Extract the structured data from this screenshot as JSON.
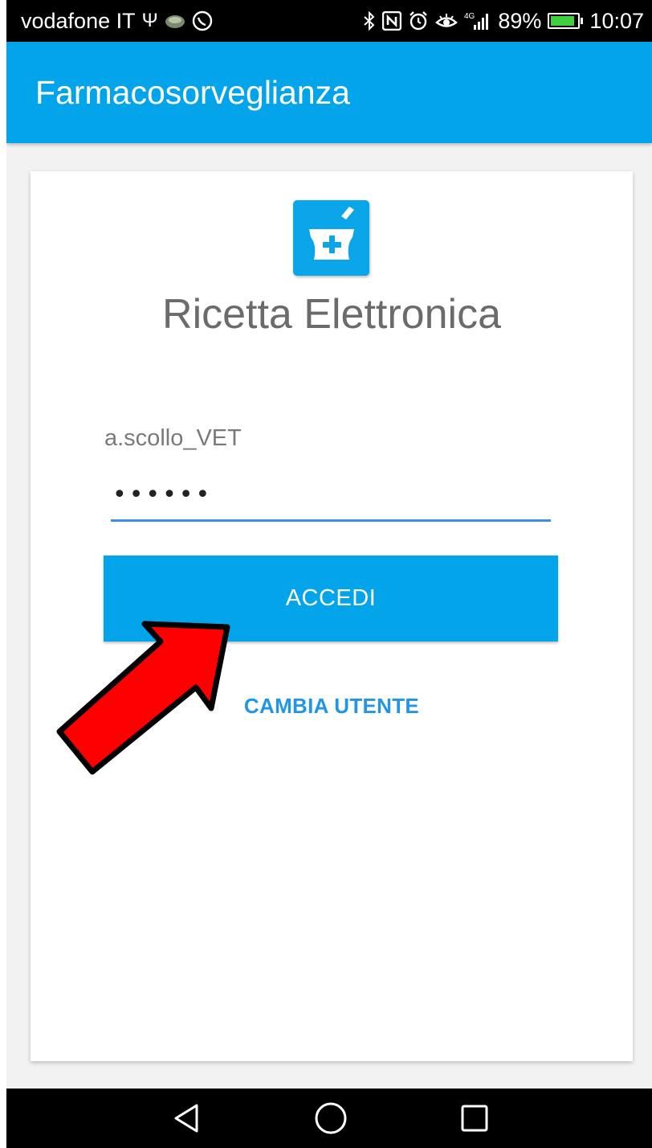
{
  "status_bar": {
    "carrier": "vodafone IT",
    "icons_left": [
      "usb-icon",
      "cloud-sync-icon",
      "whatsapp-icon"
    ],
    "icons_right": [
      "bluetooth-icon",
      "nfc-icon",
      "alarm-icon",
      "eye-icon",
      "signal-4g-icon"
    ],
    "network_label": "4G",
    "battery": "89%",
    "battery_level": 0.89,
    "time": "10:07"
  },
  "app_bar": {
    "title": "Farmacosorveglianza"
  },
  "login": {
    "app_icon": "mortar-pestle-plus-icon",
    "heading": "Ricetta Elettronica",
    "username": "a.scollo_VET",
    "password_value": "••••••",
    "submit_label": "ACCEDI",
    "change_user_label": "CAMBIA UTENTE"
  },
  "annotation": {
    "arrow_color": "#ff0000",
    "points_to": "ACCEDI"
  },
  "colors": {
    "primary": "#03a4ea",
    "accent": "#2196e8",
    "text_gray": "#6b6b6b"
  },
  "nav_bar": {
    "buttons": [
      "back-icon",
      "home-icon",
      "recents-icon"
    ]
  }
}
